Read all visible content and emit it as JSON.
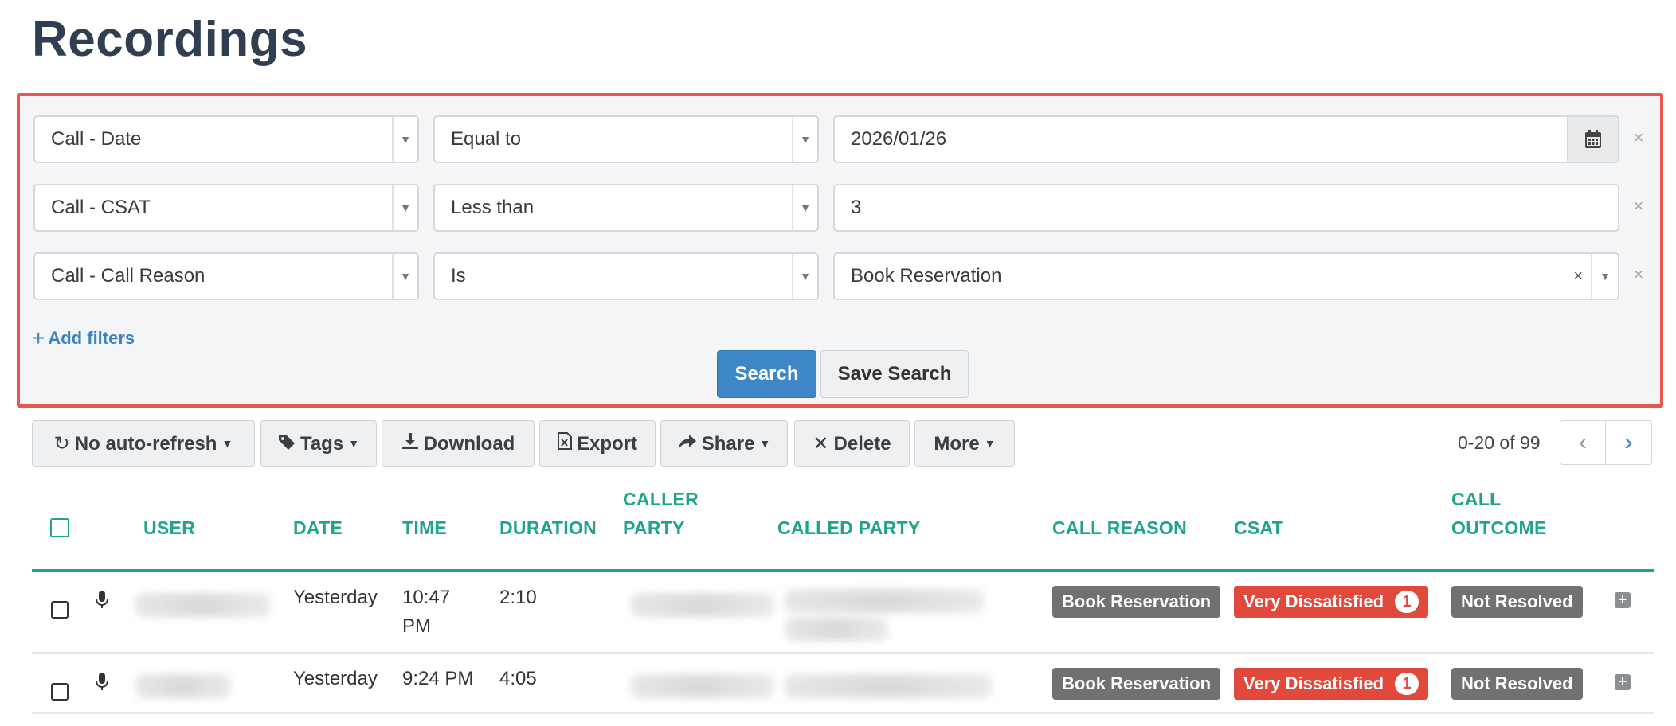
{
  "page": {
    "title": "Recordings"
  },
  "filters": [
    {
      "field": "Call - Date",
      "operator": "Equal to",
      "value": "2026/01/26",
      "value_type": "date"
    },
    {
      "field": "Call - CSAT",
      "operator": "Less than",
      "value": "3",
      "value_type": "text"
    },
    {
      "field": "Call - Call Reason",
      "operator": "Is",
      "value": "Book Reservation",
      "value_type": "select"
    }
  ],
  "filter_panel": {
    "add_filters_label": "Add filters",
    "search_label": "Search",
    "save_search_label": "Save Search",
    "remove_icon": "×",
    "clear_icon": "×",
    "caret_icon": "▼"
  },
  "toolbar": {
    "auto_refresh_label": "No auto-refresh",
    "tags_label": "Tags",
    "download_label": "Download",
    "export_label": "Export",
    "share_label": "Share",
    "delete_label": "Delete",
    "more_label": "More",
    "pagination_text": "0-20 of 99"
  },
  "table": {
    "headers": {
      "user": "USER",
      "date": "DATE",
      "time": "TIME",
      "duration": "DURATION",
      "caller_party_1": "CALLER",
      "caller_party_2": "PARTY",
      "called_party": "CALLED PARTY",
      "call_reason": "CALL REASON",
      "csat": "CSAT",
      "call_outcome_1": "CALL",
      "call_outcome_2": "OUTCOME"
    },
    "rows": [
      {
        "date": "Yesterday",
        "time_1": "10:47",
        "time_2": "PM",
        "duration": "2:10",
        "call_reason": "Book Reservation",
        "csat": "Very Dissatisfied",
        "csat_score": "1",
        "call_outcome": "Not Resolved"
      },
      {
        "date": "Yesterday",
        "time_1": "9:24 PM",
        "time_2": "",
        "duration": "4:05",
        "call_reason": "Book Reservation",
        "csat": "Very Dissatisfied",
        "csat_score": "1",
        "call_outcome": "Not Resolved"
      }
    ]
  },
  "colors": {
    "accent_teal": "#1fa38a",
    "primary_blue": "#3d87c9",
    "panel_border_red": "#e8594d",
    "label_red": "#e2493d",
    "label_gray": "#717171"
  },
  "icons": {
    "calendar": "calendar-icon",
    "refresh": "refresh-icon",
    "tag": "tag-icon",
    "download": "download-icon",
    "export": "excel-export-icon",
    "share": "share-icon",
    "delete": "close-icon",
    "mic": "microphone-icon",
    "expand": "plus-square-icon"
  }
}
